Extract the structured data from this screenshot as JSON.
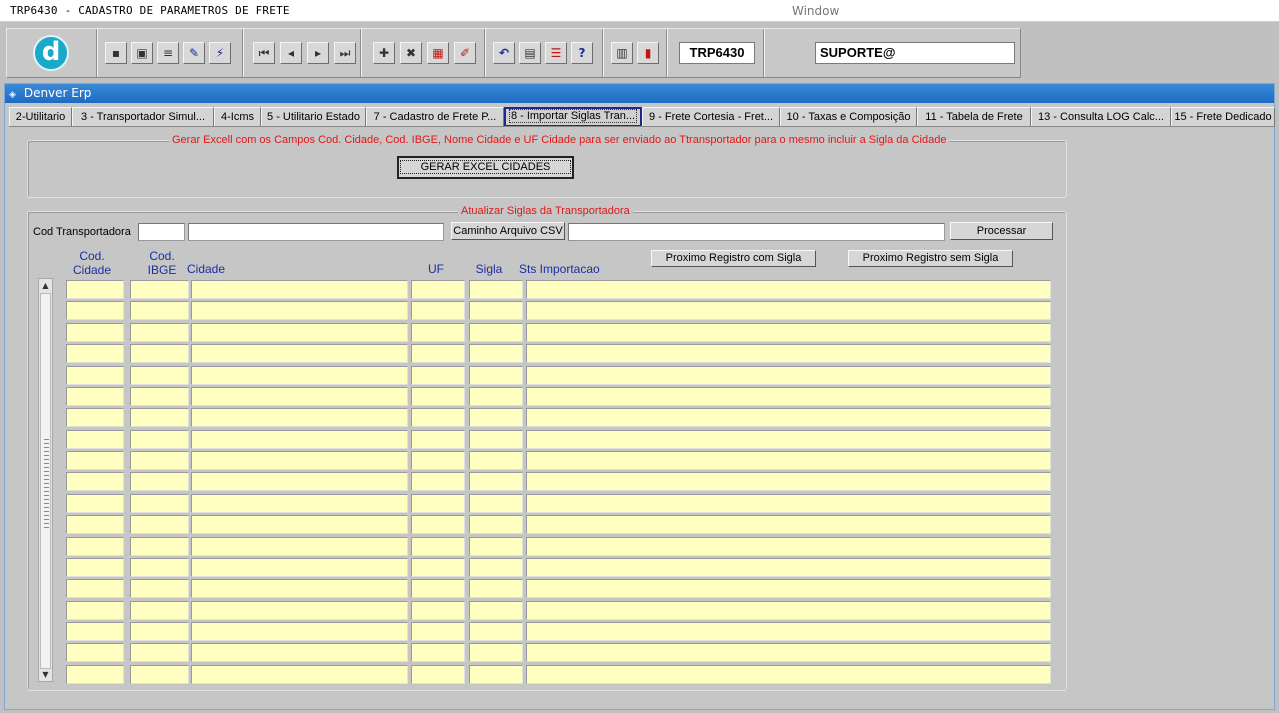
{
  "window": {
    "title": "TRP6430 - CADASTRO DE PARAMETROS DE FRETE",
    "caption": "Window"
  },
  "toolbar": {
    "logo_letter": "d",
    "form_code": "TRP6430",
    "user": "SUPORTE@",
    "icons": [
      "save-icon",
      "print-preview-icon",
      "print-icon",
      "query-icon",
      "execute-query-icon",
      "first-record-icon",
      "previous-record-icon",
      "next-record-icon",
      "last-record-icon",
      "insert-record-icon",
      "delete-record-icon",
      "clear-icon",
      "edit-icon",
      "undo-icon",
      "clipboard-icon",
      "list-icon",
      "help-icon",
      "menu-icon",
      "exit-icon"
    ],
    "help_glyph": "?"
  },
  "frame": {
    "title": "Denver Erp"
  },
  "tabs": [
    {
      "label": "2-Utilitario"
    },
    {
      "label": "3 - Transportador Simul..."
    },
    {
      "label": "4-Icms"
    },
    {
      "label": "5 - Utilitario Estado"
    },
    {
      "label": "7 - Cadastro de Frete P..."
    },
    {
      "label": "8 - Importar Siglas Tran...",
      "active": true
    },
    {
      "label": "9 - Frete Cortesia - Fret..."
    },
    {
      "label": "10 - Taxas e Composição"
    },
    {
      "label": "11 - Tabela de Frete"
    },
    {
      "label": "13 - Consulta LOG Calc..."
    },
    {
      "label": "15 - Frete Dedicado"
    }
  ],
  "excel_section": {
    "label": "Gerar Excell com os Campos Cod. Cidade, Cod. IBGE, Nome Cidade e UF Cidade para ser enviado ao Ttransportador para o mesmo incluir a Sigla da Cidade",
    "button": "GERAR EXCEL CIDADES"
  },
  "siglas_section": {
    "label": "Atualizar Siglas da Transportadora",
    "cod_transportadora_label": "Cod Transportadora",
    "cod_transportadora_value": "",
    "transportadora_nome_value": "",
    "caminho_button": "Caminho Arquivo CSV",
    "caminho_value": "",
    "processar_button": "Processar",
    "next_with_sigla_button": "Proximo Registro com Sigla",
    "next_without_sigla_button": "Proximo Registro sem Sigla",
    "columns": {
      "cod_cidade": "Cod. Cidade",
      "cod_ibge": "Cod. IBGE",
      "cidade": "Cidade",
      "uf": "UF",
      "sigla": "Sigla",
      "sts": "Sts Importacao"
    },
    "row_count": 19
  }
}
